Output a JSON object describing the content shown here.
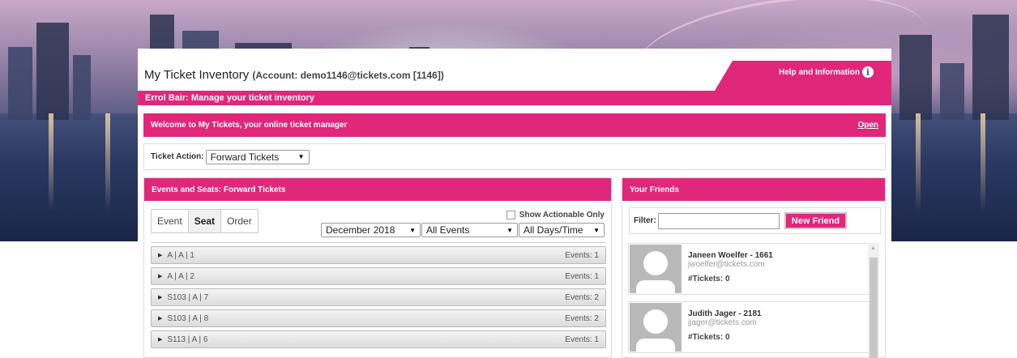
{
  "page": {
    "title": "My Ticket Inventory",
    "account": "(Account: demo1146@tickets.com [1146])",
    "help_label": "Help and Information",
    "help_icon": "info-icon",
    "manage_bar": "Errol Bair: Manage your ticket inventory"
  },
  "welcome": {
    "text": "Welcome to My Tickets, your online ticket manager",
    "open_label": "Open"
  },
  "ticket_action": {
    "label": "Ticket Action:",
    "value": "Forward Tickets"
  },
  "events": {
    "header": "Events and Seats: Forward Tickets",
    "view_tabs": [
      "Event",
      "Seat",
      "Order"
    ],
    "active_tab": "Seat",
    "show_actionable_label": "Show Actionable Only",
    "show_actionable_checked": false,
    "month_filter": "December 2018",
    "event_filter": "All Events",
    "time_filter": "All Days/Time",
    "seats": [
      {
        "label": "A | A | 1",
        "events": "Events: 1"
      },
      {
        "label": "A | A | 2",
        "events": "Events: 1"
      },
      {
        "label": "S103 | A | 7",
        "events": "Events: 2"
      },
      {
        "label": "S103 | A | 8",
        "events": "Events: 2"
      },
      {
        "label": "S113 | A | 6",
        "events": "Events: 1"
      }
    ]
  },
  "friends": {
    "header": "Your Friends",
    "filter_label": "Filter:",
    "filter_value": "",
    "new_friend_label": "New Friend",
    "list": [
      {
        "name": "Janeen Woelfer - 1661",
        "email": "jwoelfer@tickets.com",
        "tickets": "#Tickets: 0"
      },
      {
        "name": "Judith Jager - 2181",
        "email": "jjager@tickets.com",
        "tickets": "#Tickets: 0"
      }
    ]
  },
  "colors": {
    "accent": "#e0277a"
  }
}
